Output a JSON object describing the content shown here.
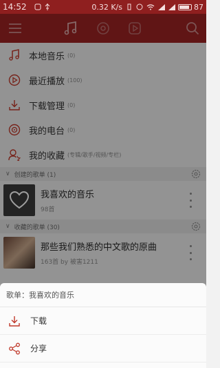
{
  "status_bar": {
    "time": "14:52",
    "network_speed": "0.32 K/s",
    "battery": "87"
  },
  "menu": [
    {
      "label": "本地音乐",
      "count": "(0)",
      "icon": "music-note-icon"
    },
    {
      "label": "最近播放",
      "count": "(100)",
      "icon": "recent-play-icon"
    },
    {
      "label": "下载管理",
      "count": "(0)",
      "icon": "download-icon"
    },
    {
      "label": "我的电台",
      "count": "(0)",
      "icon": "radio-icon"
    },
    {
      "label": "我的收藏",
      "count": "(专辑/歌手/视频/专栏)",
      "icon": "collection-icon"
    }
  ],
  "created_section": {
    "label": "创建的歌单 (1)"
  },
  "created_playlists": [
    {
      "title": "我喜欢的音乐",
      "subtitle": "98首"
    }
  ],
  "collected_section": {
    "label": "收藏的歌单 (30)"
  },
  "collected_playlists": [
    {
      "title": "那些我们熟悉的中文歌的原曲",
      "subtitle": "163首 by 被害1211"
    }
  ],
  "sheet": {
    "title": "歌单：我喜欢的音乐",
    "actions": [
      {
        "label": "下载",
        "icon": "download-icon"
      },
      {
        "label": "分享",
        "icon": "share-icon"
      }
    ]
  },
  "colors": {
    "brand": "#9b2323",
    "status_bar": "#8f1f1f",
    "accent_icon": "#c0392b"
  }
}
